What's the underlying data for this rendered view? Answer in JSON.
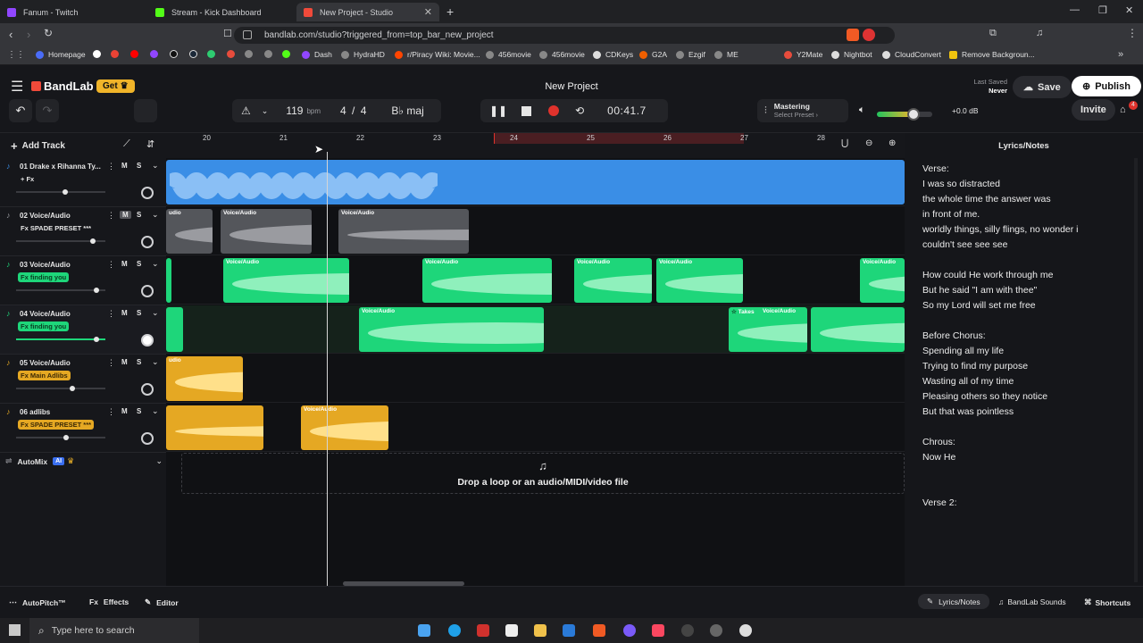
{
  "browser": {
    "tabs": [
      {
        "label": "Fanum - Twitch",
        "color": "#9146ff"
      },
      {
        "label": "Stream - Kick Dashboard",
        "color": "#53fc18"
      },
      {
        "label": "New Project - Studio",
        "color": "#f04a3a"
      }
    ],
    "url": "bandlab.com/studio?triggered_from=top_bar_new_project",
    "bookmarks": [
      "Homepage",
      "Dash",
      "HydraHD",
      "r/Piracy Wiki: Movie...",
      "456movie",
      "456movie",
      "CDKeys",
      "G2A",
      "Ezgif",
      "ME",
      "Y2Mate",
      "Nightbot",
      "CloudConvert",
      "Remove Backgroun..."
    ]
  },
  "app": {
    "brand": "BandLab",
    "get_label": "Get",
    "project_title": "New Project",
    "last_saved_label": "Last Saved",
    "last_saved_value": "Never",
    "save_label": "Save",
    "publish_label": "Publish",
    "invite_label": "Invite",
    "cart_count": "4"
  },
  "transport": {
    "bpm": "119",
    "bpm_unit": "bpm",
    "time_sig_num": "4",
    "time_sig_sep": "/",
    "time_sig_den": "4",
    "key": "B♭ maj",
    "time": "00:41.7",
    "mastering_label": "Mastering",
    "mastering_preset": "Select Preset",
    "master_volume_db": "+0.0 dB",
    "master_volume_level": 0.66
  },
  "timeline": {
    "add_track_label": "Add Track",
    "ruler_bars": [
      "20",
      "21",
      "22",
      "23",
      "24",
      "25",
      "26",
      "27",
      "28"
    ],
    "drop_zone_text": "Drop a loop or an audio/MIDI/video file"
  },
  "tracks": [
    {
      "name": "01  Drake x Rihanna Ty...",
      "fx": "+ Fx",
      "fx_style": "plain",
      "volume": 0.55,
      "mute": "M",
      "solo": "S"
    },
    {
      "name": "02  Voice/Audio",
      "fx": "Fx  SPADE PRESET ***",
      "fx_style": "plain",
      "volume": 0.86,
      "mute": "M",
      "solo": "S"
    },
    {
      "name": "03  Voice/Audio",
      "fx": "Fx  finding you",
      "fx_style": "green",
      "volume": 0.9,
      "mute": "M",
      "solo": "S"
    },
    {
      "name": "04  Voice/Audio",
      "fx": "Fx  finding you",
      "fx_style": "green",
      "volume": 0.9,
      "mute": "M",
      "solo": "S"
    },
    {
      "name": "05  Voice/Audio",
      "fx": "Fx  Main Adlibs",
      "fx_style": "yellow",
      "volume": 0.63,
      "mute": "M",
      "solo": "S"
    },
    {
      "name": "06  adlibs",
      "fx": "Fx  SPADE PRESET ***",
      "fx_style": "yellow",
      "volume": 0.56,
      "mute": "M",
      "solo": "S"
    }
  ],
  "clip_label": "Voice/Audio",
  "takes_label": "Takes",
  "automix": {
    "label": "AutoMix",
    "badge": "AI"
  },
  "lyrics": {
    "header": "Lyrics/Notes",
    "lines": [
      "Verse:",
      "I was so distracted",
      "the whole time the answer was",
      "in front of me.",
      "worldly things, silly flings, no wonder i",
      "couldn't see see see",
      "",
      "How could He work through me",
      "But he said \"I am with thee\"",
      "So my Lord will set me free",
      "",
      "Before Chorus:",
      "Spending all my life",
      "Trying to find my purpose",
      "Wasting all of my time",
      "Pleasing others so they notice",
      "But that was pointless",
      "",
      "Chrous:",
      "Now He",
      "",
      "",
      "Verse 2:"
    ]
  },
  "bottom": {
    "autopitch": "AutoPitch™",
    "effects": "Effects",
    "editor": "Editor",
    "lyrics_notes": "Lyrics/Notes",
    "sounds": "BandLab Sounds",
    "shortcuts": "Shortcuts"
  },
  "taskbar": {
    "search_placeholder": "Type here to search"
  },
  "colors": {
    "blue": "#3a8ee6",
    "gray": "#54565b",
    "green": "#1ed67a",
    "yellow": "#e5a823",
    "brand": "#f04a3a"
  }
}
